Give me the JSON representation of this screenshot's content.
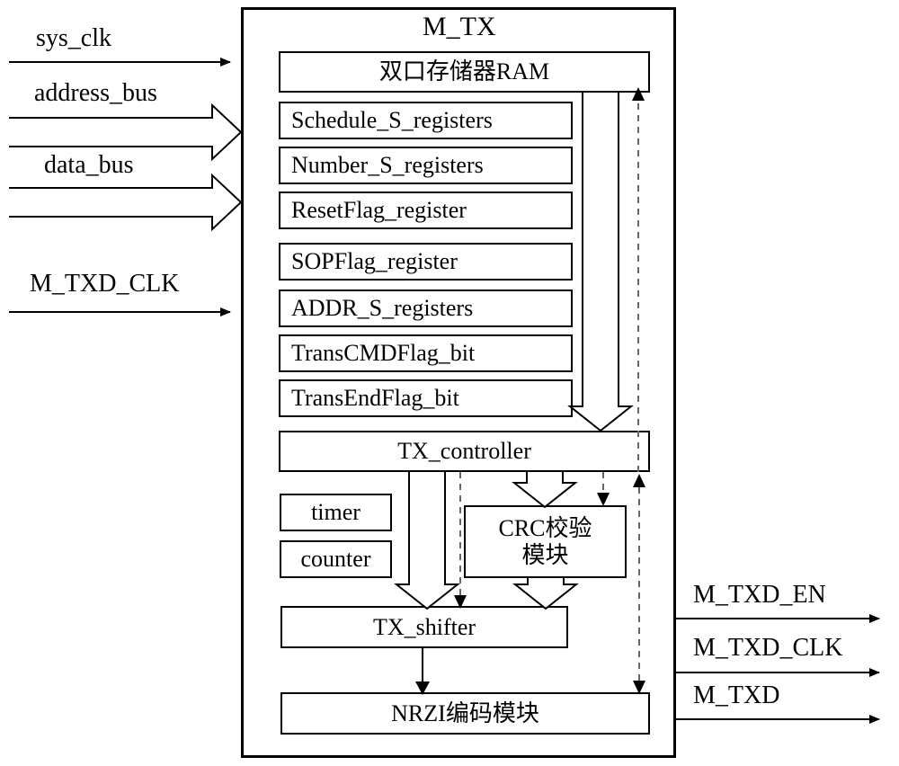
{
  "diagram": {
    "title": "M_TX",
    "module": {
      "name": "M_TX",
      "label": "M_TX"
    },
    "inputs": [
      {
        "label": "sys_clk",
        "arrow": "solid-thin",
        "name": "input-sys-clk"
      },
      {
        "label": "address_bus",
        "arrow": "hollow-block",
        "name": "input-address-bus"
      },
      {
        "label": "data_bus",
        "arrow": "hollow-block",
        "name": "input-data-bus"
      },
      {
        "label": "M_TXD_CLK",
        "arrow": "solid-thin",
        "name": "input-m-txd-clk"
      }
    ],
    "outputs": [
      {
        "label": "M_TXD_EN",
        "arrow": "solid-thin",
        "name": "output-m-txd-en"
      },
      {
        "label": "M_TXD_CLK",
        "arrow": "solid-thin",
        "name": "output-m-txd-clk"
      },
      {
        "label": "M_TXD",
        "arrow": "solid-thin",
        "name": "output-m-txd"
      }
    ],
    "blocks": {
      "ram": "双口存储器RAM",
      "schedule_registers": "Schedule_S_registers",
      "number_registers": "Number_S_registers",
      "resetflag_register": "ResetFlag_register",
      "sopflag_register": "SOPFlag_register",
      "addr_registers": "ADDR_S_registers",
      "transcmdflag_bit": "TransCMDFlag_bit",
      "transendflag_bit": "TransEndFlag_bit",
      "tx_controller": "TX_controller",
      "timer": "timer",
      "counter": "counter",
      "crc_line1": "CRC校验",
      "crc_line2": "模块",
      "tx_shifter": "TX_shifter",
      "nrzi": "NRZI编码模块"
    },
    "colors": {
      "stroke": "#000000",
      "dashed": "#777777",
      "background": "#ffffff"
    }
  }
}
